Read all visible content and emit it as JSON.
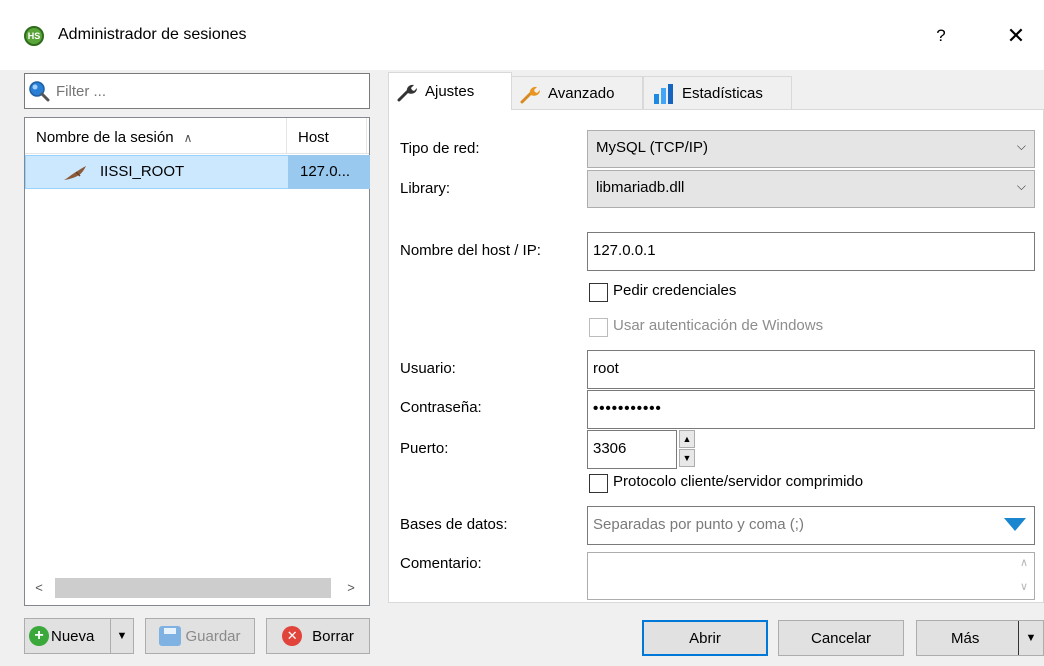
{
  "window": {
    "app_icon_text": "HS",
    "title": "Administrador de sesiones",
    "help_label": "?",
    "close_label": "✕"
  },
  "filter": {
    "placeholder": "Filter ..."
  },
  "session_list": {
    "columns": {
      "name": "Nombre de la sesión",
      "host": "Host"
    },
    "sort_indicator": "^",
    "rows": [
      {
        "name": "IISSI_ROOT",
        "host": "127.0..."
      }
    ],
    "scroll_left": "<",
    "scroll_right": ">"
  },
  "left_buttons": {
    "new": "Nueva",
    "save": "Guardar",
    "delete": "Borrar"
  },
  "tabs": [
    {
      "label": "Ajustes",
      "active": true
    },
    {
      "label": "Avanzado",
      "active": false
    },
    {
      "label": "Estadísticas",
      "active": false
    }
  ],
  "settings": {
    "network_type": {
      "label": "Tipo de red:",
      "value": "MySQL (TCP/IP)"
    },
    "library": {
      "label": "Library:",
      "value": "libmariadb.dll"
    },
    "host": {
      "label": "Nombre del host / IP:",
      "value": "127.0.0.1"
    },
    "ask_credentials": {
      "label": "Pedir credenciales",
      "checked": false
    },
    "windows_auth": {
      "label": "Usar autenticación de Windows",
      "checked": false,
      "enabled": false
    },
    "user": {
      "label": "Usuario:",
      "value": "root"
    },
    "password": {
      "label": "Contraseña:",
      "value": "•••••••••••"
    },
    "port": {
      "label": "Puerto:",
      "value": "3306"
    },
    "compressed": {
      "label": "Protocolo cliente/servidor comprimido",
      "checked": false
    },
    "databases": {
      "label": "Bases de datos:",
      "placeholder": "Separadas por punto y coma (;)"
    },
    "comment": {
      "label": "Comentario:",
      "value": ""
    }
  },
  "footer_buttons": {
    "open": "Abrir",
    "cancel": "Cancelar",
    "more": "Más"
  },
  "colors": {
    "accent": "#0078d7",
    "selection": "#cce8ff",
    "dropdown_arrow": "#1a86d0"
  }
}
